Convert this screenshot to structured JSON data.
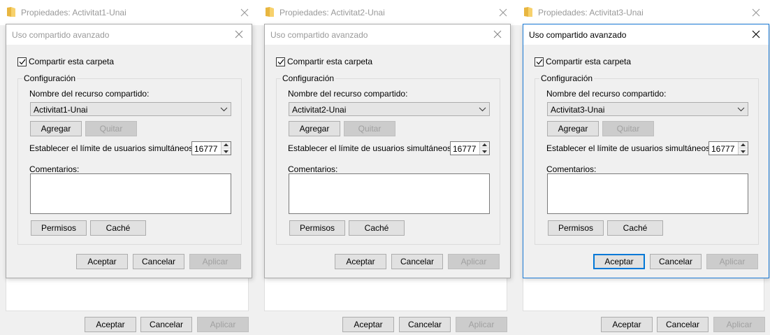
{
  "panels": [
    {
      "props_title": "Propiedades: Activitat1-Unai",
      "dialog_title": "Uso compartido avanzado",
      "dialog_active": false,
      "share_checkbox_label": "Compartir esta carpeta",
      "share_checked": true,
      "group_label": "Configuración",
      "share_name_label": "Nombre del recurso compartido:",
      "share_name_value": "Activitat1-Unai",
      "add_button": "Agregar",
      "remove_button": "Quitar",
      "limit_label": "Establecer el límite de usuarios simultáneos en:",
      "limit_value": "16777",
      "comments_label": "Comentarios:",
      "permissions_button": "Permisos",
      "cache_button": "Caché",
      "ok_button": "Aceptar",
      "cancel_button": "Cancelar",
      "apply_button": "Aplicar",
      "props_ok_button": "Aceptar",
      "props_cancel_button": "Cancelar",
      "props_apply_button": "Aplicar"
    },
    {
      "props_title": "Propiedades: Activitat2-Unai",
      "dialog_title": "Uso compartido avanzado",
      "dialog_active": false,
      "share_checkbox_label": "Compartir esta carpeta",
      "share_checked": true,
      "group_label": "Configuración",
      "share_name_label": "Nombre del recurso compartido:",
      "share_name_value": "Activitat2-Unai",
      "add_button": "Agregar",
      "remove_button": "Quitar",
      "limit_label": "Establecer el límite de usuarios simultáneos en:",
      "limit_value": "16777",
      "comments_label": "Comentarios:",
      "permissions_button": "Permisos",
      "cache_button": "Caché",
      "ok_button": "Aceptar",
      "cancel_button": "Cancelar",
      "apply_button": "Aplicar",
      "props_ok_button": "Aceptar",
      "props_cancel_button": "Cancelar",
      "props_apply_button": "Aplicar"
    },
    {
      "props_title": "Propiedades: Activitat3-Unai",
      "dialog_title": "Uso compartido avanzado",
      "dialog_active": true,
      "share_checkbox_label": "Compartir esta carpeta",
      "share_checked": true,
      "group_label": "Configuración",
      "share_name_label": "Nombre del recurso compartido:",
      "share_name_value": "Activitat3-Unai",
      "add_button": "Agregar",
      "remove_button": "Quitar",
      "limit_label": "Establecer el límite de usuarios simultáneos en:",
      "limit_value": "16777",
      "comments_label": "Comentarios:",
      "permissions_button": "Permisos",
      "cache_button": "Caché",
      "ok_button": "Aceptar",
      "cancel_button": "Cancelar",
      "apply_button": "Aplicar",
      "props_ok_button": "Aceptar",
      "props_cancel_button": "Cancelar",
      "props_apply_button": "Aplicar"
    }
  ],
  "colors": {
    "active_border": "#1a7ad6",
    "inactive_title": "#999999",
    "folder_icon": "#e8b640"
  },
  "icons": {
    "folder": "folder-icon",
    "close": "close-icon",
    "dropdown": "chevron-down-icon",
    "spin_up": "spin-up-icon",
    "spin_down": "spin-down-icon",
    "check": "checkmark-icon"
  }
}
